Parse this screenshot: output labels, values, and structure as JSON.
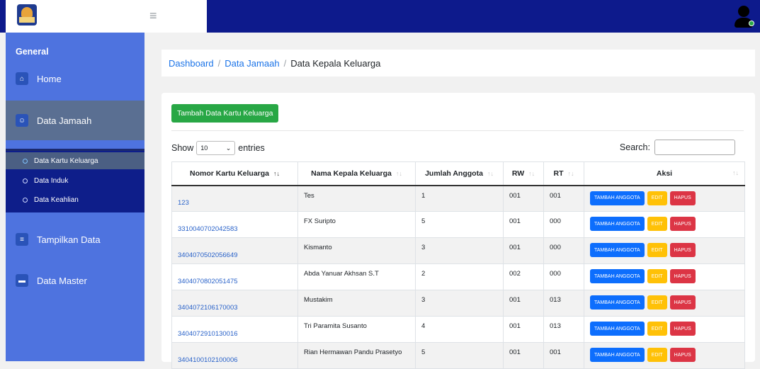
{
  "breadcrumb": {
    "items": [
      "Dashboard",
      "Data Jamaah"
    ],
    "current": "Data Kepala Keluarga",
    "separator": "/"
  },
  "sidebar": {
    "heading": "General",
    "items": [
      {
        "label": "Home",
        "icon": "home-icon"
      },
      {
        "label": "Data Jamaah",
        "icon": "users-icon"
      },
      {
        "label": "Tampilkan Data",
        "icon": "list-icon"
      },
      {
        "label": "Data Master",
        "icon": "briefcase-icon"
      }
    ],
    "sub_items": [
      "Data Kartu Keluarga",
      "Data Induk",
      "Data Keahlian"
    ]
  },
  "main": {
    "add_button": "Tambah Data Kartu Keluarga",
    "show_label": "Show",
    "entries_label": "entries",
    "entries_value": "10",
    "search_label": "Search:"
  },
  "table": {
    "columns": [
      "Nomor Kartu Keluarga",
      "Nama Kepala Keluarga",
      "Jumlah Anggota",
      "RW",
      "RT",
      "Aksi"
    ],
    "rows": [
      [
        "123",
        "Tes",
        "1",
        "001",
        "001"
      ],
      [
        "3310040702042583",
        "FX Suripto",
        "5",
        "001",
        "000"
      ],
      [
        "3404070502056649",
        "Kismanto",
        "3",
        "001",
        "000"
      ],
      [
        "3404070802051475",
        "Abda Yanuar Akhsan S.T",
        "2",
        "002",
        "000"
      ],
      [
        "3404072106170003",
        "Mustakim",
        "3",
        "001",
        "013"
      ],
      [
        "3404072910130016",
        "Tri Paramita Susanto",
        "4",
        "001",
        "013"
      ],
      [
        "3404100102100006",
        "Rian Hermawan Pandu Prasetyo",
        "5",
        "001",
        "001"
      ]
    ],
    "actions": {
      "add": "TAMBAH ANGGOTA",
      "edit": "EDIT",
      "delete": "HAPUS"
    }
  },
  "colors": {
    "topbar": "#0d1a8c",
    "sidebar": "#4e73df",
    "submenu": "#0e1e8a",
    "add_button": "#28a745",
    "btn_blue": "#0d6efd",
    "btn_yellow": "#ffc107",
    "btn_red": "#dc3545"
  }
}
